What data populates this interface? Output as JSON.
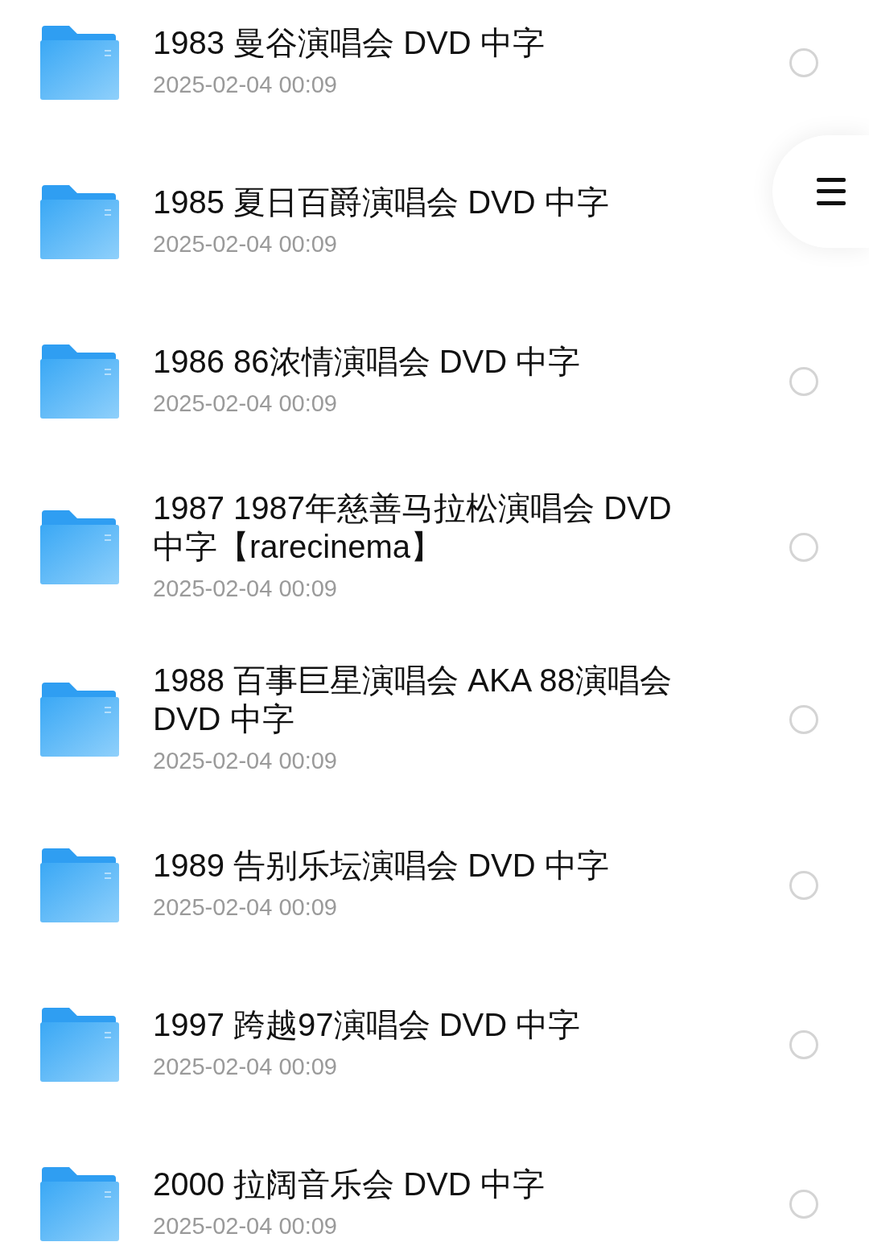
{
  "files": [
    {
      "title": "1983 曼谷演唱会 DVD 中字",
      "date": "2025-02-04 00:09",
      "selected": false
    },
    {
      "title": "1985 夏日百爵演唱会 DVD 中字",
      "date": "2025-02-04 00:09"
    },
    {
      "title": "1986 86浓情演唱会 DVD 中字",
      "date": "2025-02-04 00:09",
      "selected": false
    },
    {
      "title": "1987 1987年慈善马拉松演唱会 DVD 中字【rarecinema】",
      "date": "2025-02-04 00:09",
      "selected": false
    },
    {
      "title": "1988 百事巨星演唱会 AKA 88演唱会 DVD 中字",
      "date": "2025-02-04 00:09",
      "selected": false
    },
    {
      "title": "1989 告别乐坛演唱会 DVD 中字",
      "date": "2025-02-04 00:09",
      "selected": false
    },
    {
      "title": "1997 跨越97演唱会 DVD 中字",
      "date": "2025-02-04 00:09",
      "selected": false
    },
    {
      "title": "2000 拉阔音乐会 DVD 中字",
      "date": "2025-02-04 00:09",
      "selected": false
    }
  ],
  "floating_button": {
    "kind": "menu"
  }
}
